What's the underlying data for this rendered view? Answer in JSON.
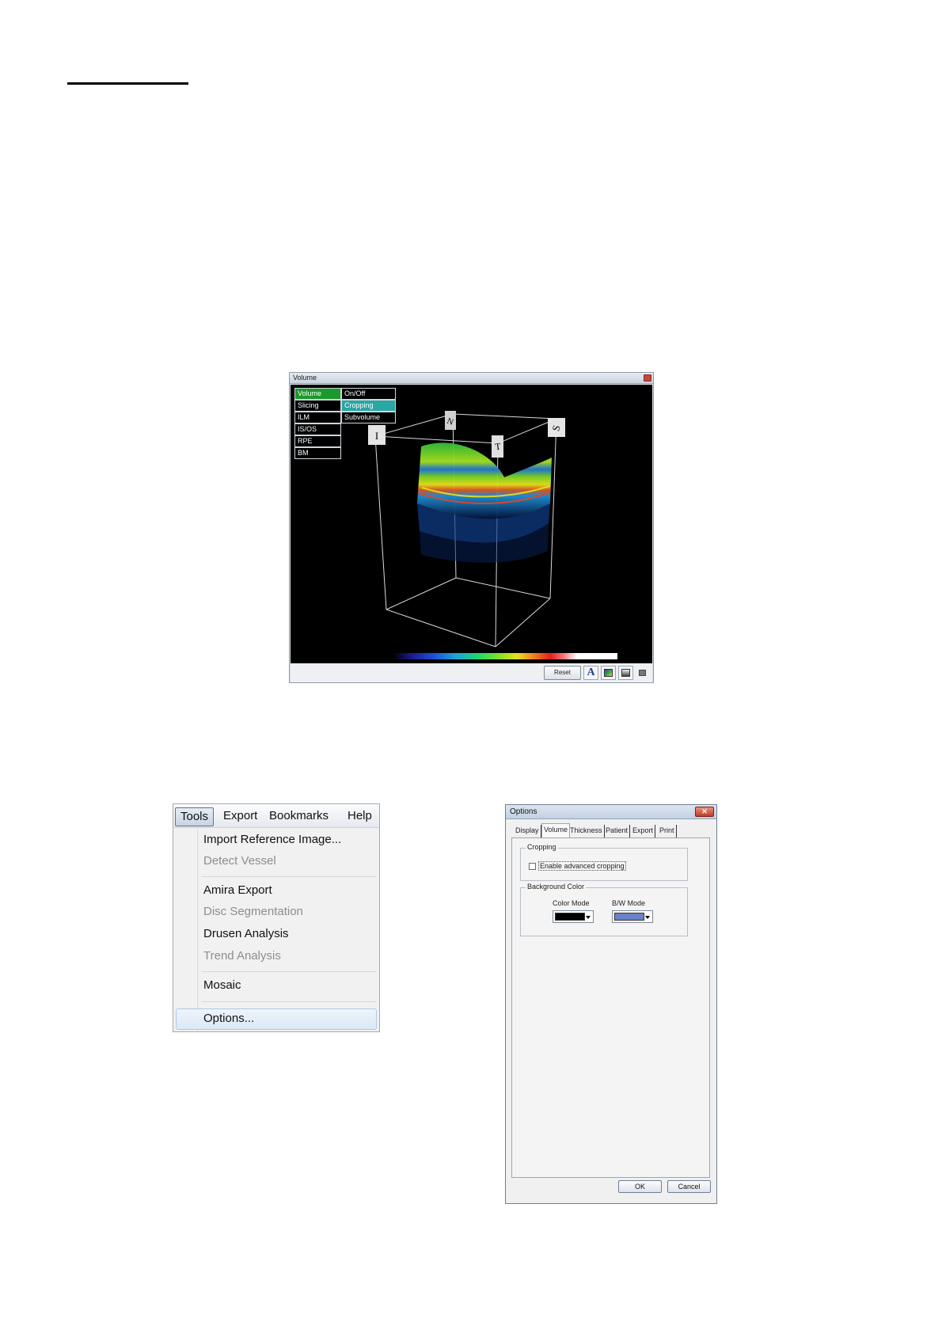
{
  "volume_window": {
    "title": "Volume",
    "layer_menu": [
      "Volume",
      "Slicing",
      "ILM",
      "IS/OS",
      "RPE",
      "BM"
    ],
    "volume_submenu": [
      "On/Off",
      "Cropping",
      "Subvolume"
    ],
    "active_layer": "Volume",
    "active_sub": "Cropping",
    "face_labels": [
      "I",
      "N",
      "T",
      "S"
    ],
    "reset_label": "Reset",
    "font_button": "A",
    "icons": [
      "close-icon",
      "font-icon",
      "color-mode-icon",
      "bw-mode-icon",
      "minimize-icon"
    ],
    "colorbar_colors": [
      "#000000",
      "#1a1a8c",
      "#1f4fd8",
      "#1fa3d8",
      "#1fd86a",
      "#8ae11f",
      "#e6e21f",
      "#ef8a1f",
      "#e31f1f",
      "#f37a7a",
      "#ffffff"
    ]
  },
  "tools_menu": {
    "menubar": [
      "Tools",
      "Export",
      "Bookmarks",
      "Help"
    ],
    "open_menu": "Tools",
    "items": [
      {
        "label": "Import Reference Image...",
        "enabled": true
      },
      {
        "label": "Detect Vessel",
        "enabled": false
      },
      {
        "label": "Amira Export",
        "enabled": true
      },
      {
        "label": "Disc Segmentation",
        "enabled": false
      },
      {
        "label": "Drusen Analysis",
        "enabled": true
      },
      {
        "label": "Trend Analysis",
        "enabled": false
      },
      {
        "label": "Mosaic",
        "enabled": true
      },
      {
        "label": "Options...",
        "enabled": true
      }
    ],
    "highlighted_item": "Options..."
  },
  "options_dialog": {
    "title": "Options",
    "close_glyph": "✕",
    "tabs": [
      "Display",
      "Volume",
      "Thickness",
      "Patient",
      "Export",
      "Print"
    ],
    "active_tab": "Volume",
    "cropping_group": "Cropping",
    "cropping_checkbox": {
      "label": "Enable advanced cropping",
      "checked": false
    },
    "background_group": "Background Color",
    "color_mode_label": "Color Mode",
    "color_mode_value": "#000000",
    "bw_mode_label": "B/W Mode",
    "bw_mode_value": "#6b82c8",
    "ok_label": "OK",
    "cancel_label": "Cancel"
  }
}
